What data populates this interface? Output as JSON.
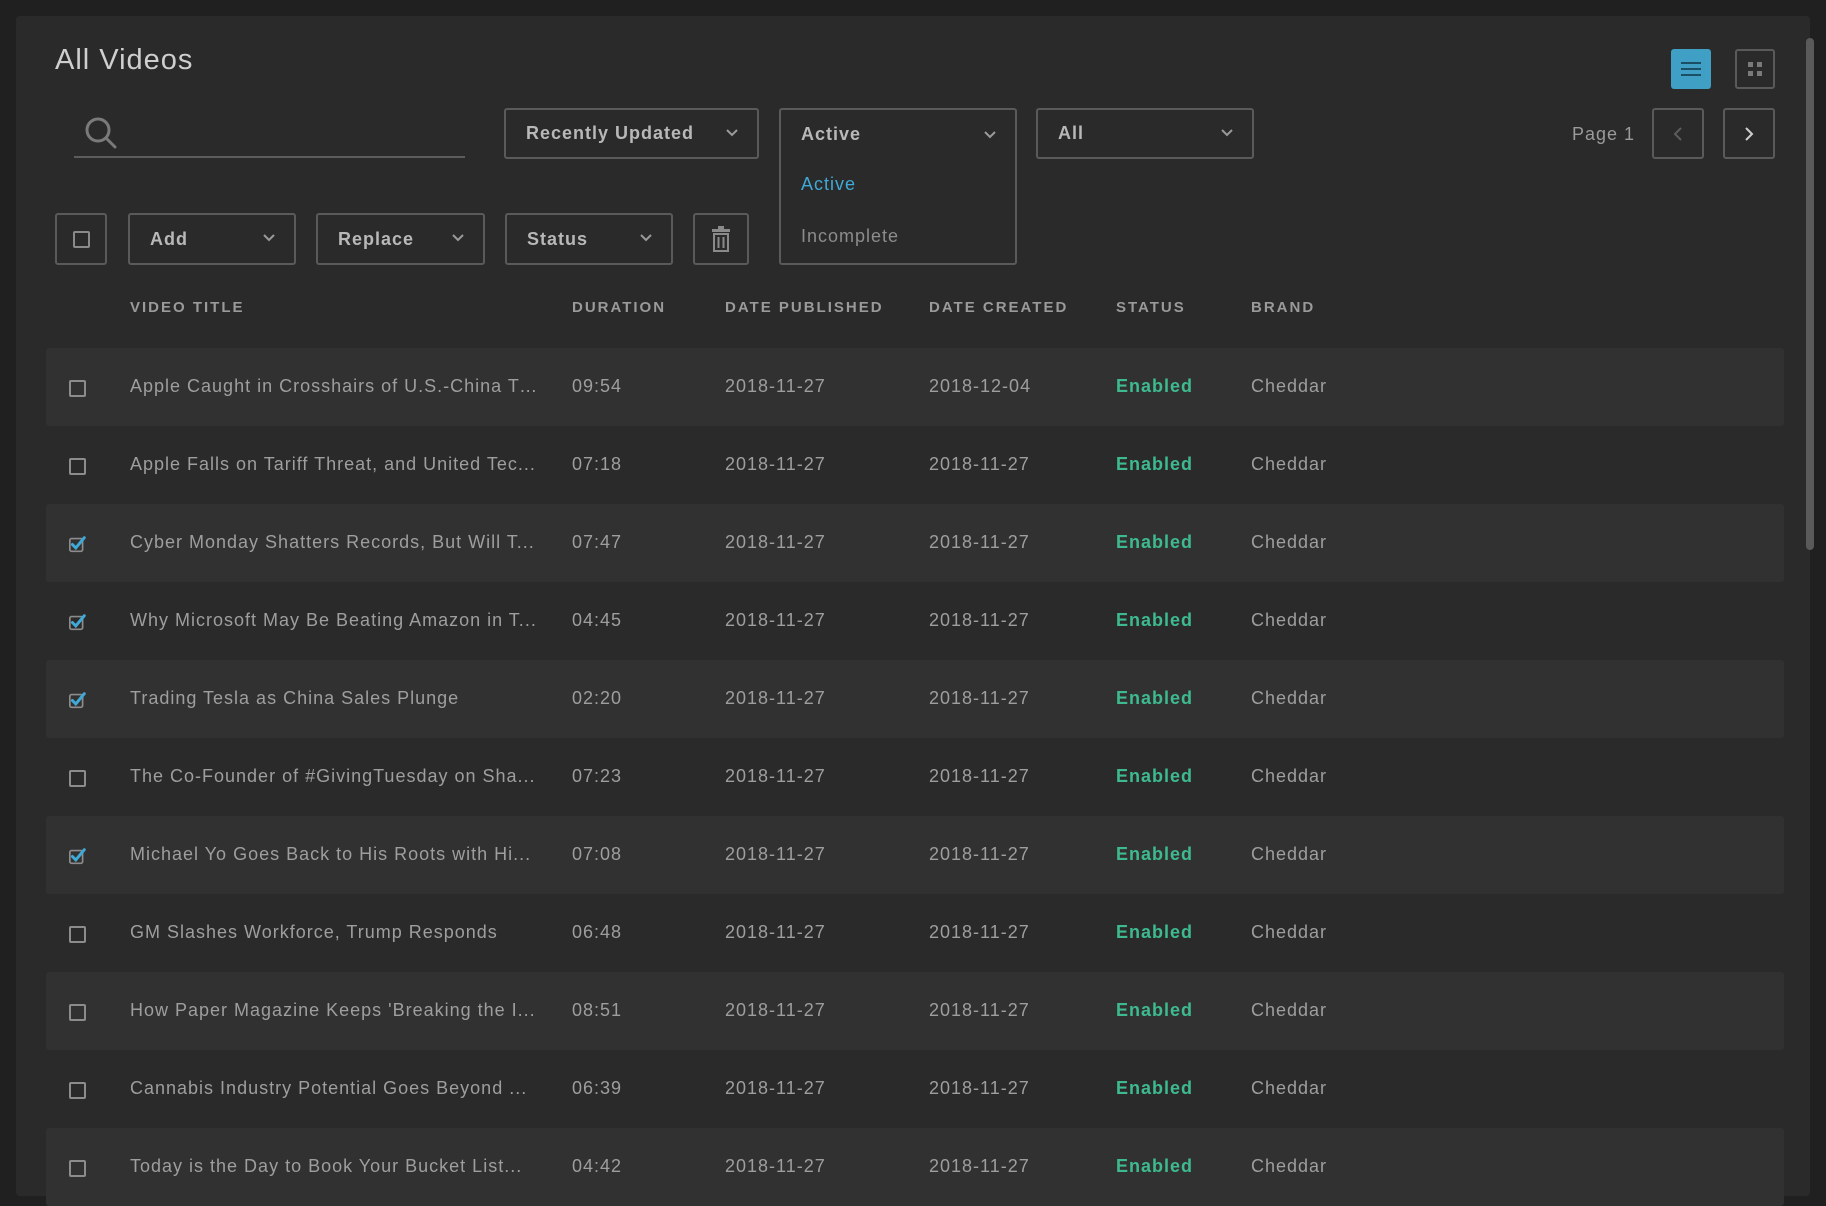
{
  "page": {
    "title": "All Videos",
    "page_label": "Page 1"
  },
  "search": {
    "placeholder": "",
    "value": ""
  },
  "filters": {
    "sort": "Recently Updated",
    "status_selected": "Active",
    "status_options": [
      "Active",
      "Incomplete"
    ],
    "brand": "All"
  },
  "bulk": {
    "add_label": "Add",
    "replace_label": "Replace",
    "status_label": "Status"
  },
  "table": {
    "columns": [
      "VIDEO TITLE",
      "DURATION",
      "DATE PUBLISHED",
      "DATE CREATED",
      "STATUS",
      "BRAND"
    ],
    "rows": [
      {
        "checked": false,
        "title": "Apple Caught in Crosshairs of U.S.-China Tr...",
        "duration": "09:54",
        "published": "2018-11-27",
        "created": "2018-12-04",
        "status": "Enabled",
        "brand": "Cheddar"
      },
      {
        "checked": false,
        "title": "Apple Falls on Tariff Threat, and United Tec...",
        "duration": "07:18",
        "published": "2018-11-27",
        "created": "2018-11-27",
        "status": "Enabled",
        "brand": "Cheddar"
      },
      {
        "checked": true,
        "title": "Cyber Monday Shatters Records, But Will T...",
        "duration": "07:47",
        "published": "2018-11-27",
        "created": "2018-11-27",
        "status": "Enabled",
        "brand": "Cheddar"
      },
      {
        "checked": true,
        "title": "Why Microsoft May Be Beating Amazon in T...",
        "duration": "04:45",
        "published": "2018-11-27",
        "created": "2018-11-27",
        "status": "Enabled",
        "brand": "Cheddar"
      },
      {
        "checked": true,
        "title": "Trading Tesla as China Sales Plunge",
        "duration": "02:20",
        "published": "2018-11-27",
        "created": "2018-11-27",
        "status": "Enabled",
        "brand": "Cheddar"
      },
      {
        "checked": false,
        "title": "The Co-Founder of #GivingTuesday on Sha...",
        "duration": "07:23",
        "published": "2018-11-27",
        "created": "2018-11-27",
        "status": "Enabled",
        "brand": "Cheddar"
      },
      {
        "checked": true,
        "title": "Michael Yo Goes Back to His Roots with Hi...",
        "duration": "07:08",
        "published": "2018-11-27",
        "created": "2018-11-27",
        "status": "Enabled",
        "brand": "Cheddar"
      },
      {
        "checked": false,
        "title": "GM Slashes Workforce, Trump Responds",
        "duration": "06:48",
        "published": "2018-11-27",
        "created": "2018-11-27",
        "status": "Enabled",
        "brand": "Cheddar"
      },
      {
        "checked": false,
        "title": "How Paper Magazine Keeps 'Breaking the I...",
        "duration": "08:51",
        "published": "2018-11-27",
        "created": "2018-11-27",
        "status": "Enabled",
        "brand": "Cheddar"
      },
      {
        "checked": false,
        "title": "Cannabis Industry Potential Goes Beyond ...",
        "duration": "06:39",
        "published": "2018-11-27",
        "created": "2018-11-27",
        "status": "Enabled",
        "brand": "Cheddar"
      },
      {
        "checked": false,
        "title": "Today is the Day to Book Your Bucket List...",
        "duration": "04:42",
        "published": "2018-11-27",
        "created": "2018-11-27",
        "status": "Enabled",
        "brand": "Cheddar"
      }
    ]
  },
  "colors": {
    "accent": "#3fa9d8",
    "enabled": "#3dbb8e",
    "background": "#2a2a2a"
  },
  "icons": [
    "list-view-icon",
    "grid-view-icon",
    "search-icon",
    "chevron-down-icon",
    "chevron-left-icon",
    "chevron-right-icon",
    "trash-icon",
    "checkbox-icon"
  ]
}
